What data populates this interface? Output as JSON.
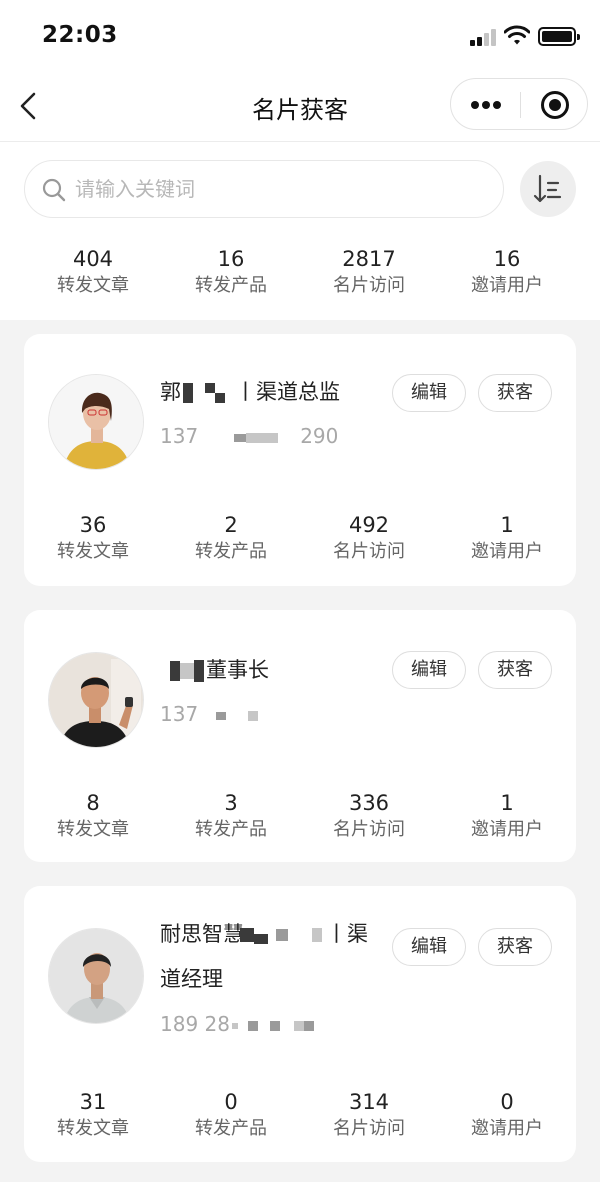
{
  "status_bar": {
    "time": "22:03"
  },
  "nav": {
    "title": "名片获客"
  },
  "search": {
    "placeholder": "请输入关键词"
  },
  "summary": [
    {
      "value": "404",
      "label": "转发文章"
    },
    {
      "value": "16",
      "label": "转发产品"
    },
    {
      "value": "2817",
      "label": "名片访问"
    },
    {
      "value": "16",
      "label": "邀请用户"
    }
  ],
  "actions": {
    "edit_label": "编辑",
    "acquire_label": "获客"
  },
  "cards": [
    {
      "name_prefix": "郭",
      "name_suffix": "丨渠道总监",
      "phone_start": "137",
      "phone_end": "290",
      "stats": [
        {
          "value": "36",
          "label": "转发文章"
        },
        {
          "value": "2",
          "label": "转发产品"
        },
        {
          "value": "492",
          "label": "名片访问"
        },
        {
          "value": "1",
          "label": "邀请用户"
        }
      ]
    },
    {
      "name_suffix": "董事长",
      "phone_start": "137",
      "stats": [
        {
          "value": "8",
          "label": "转发文章"
        },
        {
          "value": "3",
          "label": "转发产品"
        },
        {
          "value": "336",
          "label": "名片访问"
        },
        {
          "value": "1",
          "label": "邀请用户"
        }
      ]
    },
    {
      "name_prefix": "耐思智慧",
      "name_suffix": "丨渠",
      "name_line2": "道经理",
      "phone_start": "189 28",
      "stats": [
        {
          "value": "31",
          "label": "转发文章"
        },
        {
          "value": "0",
          "label": "转发产品"
        },
        {
          "value": "314",
          "label": "名片访问"
        },
        {
          "value": "0",
          "label": "邀请用户"
        }
      ]
    }
  ]
}
